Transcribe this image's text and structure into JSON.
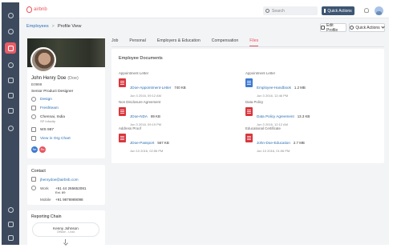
{
  "rail": {
    "icons": [
      "user-icon",
      "dashboard-icon",
      "people-icon",
      "clock-icon",
      "calendar-icon",
      "folder-icon",
      "document-icon",
      "settings-icon",
      "help-icon",
      "chat-icon",
      "apps-icon"
    ]
  },
  "topbar": {
    "brand": "airbnb",
    "search_placeholder": "Search",
    "quick_actions": "Quick Actions"
  },
  "breadcrumb": {
    "root": "Employees",
    "sep": ">",
    "current": "Profile View"
  },
  "actions": {
    "edit": "Edit Profile",
    "quick": "Quick Actions"
  },
  "profile": {
    "name": "John Henry Doe",
    "nick": "(Doe)",
    "id": "E0999",
    "title": "Senior Product Designer",
    "department": "Design",
    "employment": "Freshteam",
    "location": "Chennai, India",
    "location_sub": "SP Infocity",
    "desk": "WS 987",
    "org_chart": "View in Org Chart",
    "tags": [
      {
        "text": "Ne",
        "color": "#3d7ad1"
      },
      {
        "text": "Ro",
        "color": "#e8545f"
      }
    ]
  },
  "contact": {
    "title": "Contact",
    "email": "jhenrydoe@airbnb.com",
    "work_label": "Work",
    "work": "+91 44 265652081",
    "ext": "Ext. 89",
    "mobile_label": "Mobile",
    "mobile": "+91 9876989098"
  },
  "reporting": {
    "title": "Reporting Chain",
    "manager_name": "Kenny Johnson",
    "manager_role": "Offside - Lead"
  },
  "tabs": [
    "Job",
    "Personal",
    "Employers & Education",
    "Compensation",
    "Files"
  ],
  "documents": {
    "title": "Employee Documents",
    "items": [
      {
        "category": "Appointment Letter",
        "name": "JDoe-Appointment-Letter",
        "size": "740 KB",
        "date": "Jun 3 2016, 09:12 AM",
        "type": "pdf"
      },
      {
        "category": "Appointment Letter",
        "name": "Employee-Handbook",
        "size": "1.2 MB",
        "date": "Jun 3 2016, 12:46 PM",
        "type": "word"
      },
      {
        "category": "Non Disclosure Agreement",
        "name": "JDoe-NDA",
        "size": "89 KB",
        "date": "Jun 3 2016, 09:19 PM",
        "type": "pdf"
      },
      {
        "category": "Data Policy",
        "name": "Data Policy Agreement",
        "size": "13.3 KB",
        "date": "Jun 3 2016, 12:12 AM",
        "type": "pdf"
      },
      {
        "category": "Address Proof",
        "name": "JDoe-Passport",
        "size": "567 KB",
        "date": "Jun 10 2016, 02:56 PM",
        "type": "pdf"
      },
      {
        "category": "Educational Certificate",
        "name": "John-Doe-Education",
        "size": "2.7 MB",
        "date": "Jun 10 2016, 01:06 PM",
        "type": "pdf"
      }
    ]
  },
  "colors": {
    "rail": "#3d4a5d",
    "accent": "#e8545f",
    "link": "#2a6eb4",
    "primary_button": "#3e5673"
  }
}
